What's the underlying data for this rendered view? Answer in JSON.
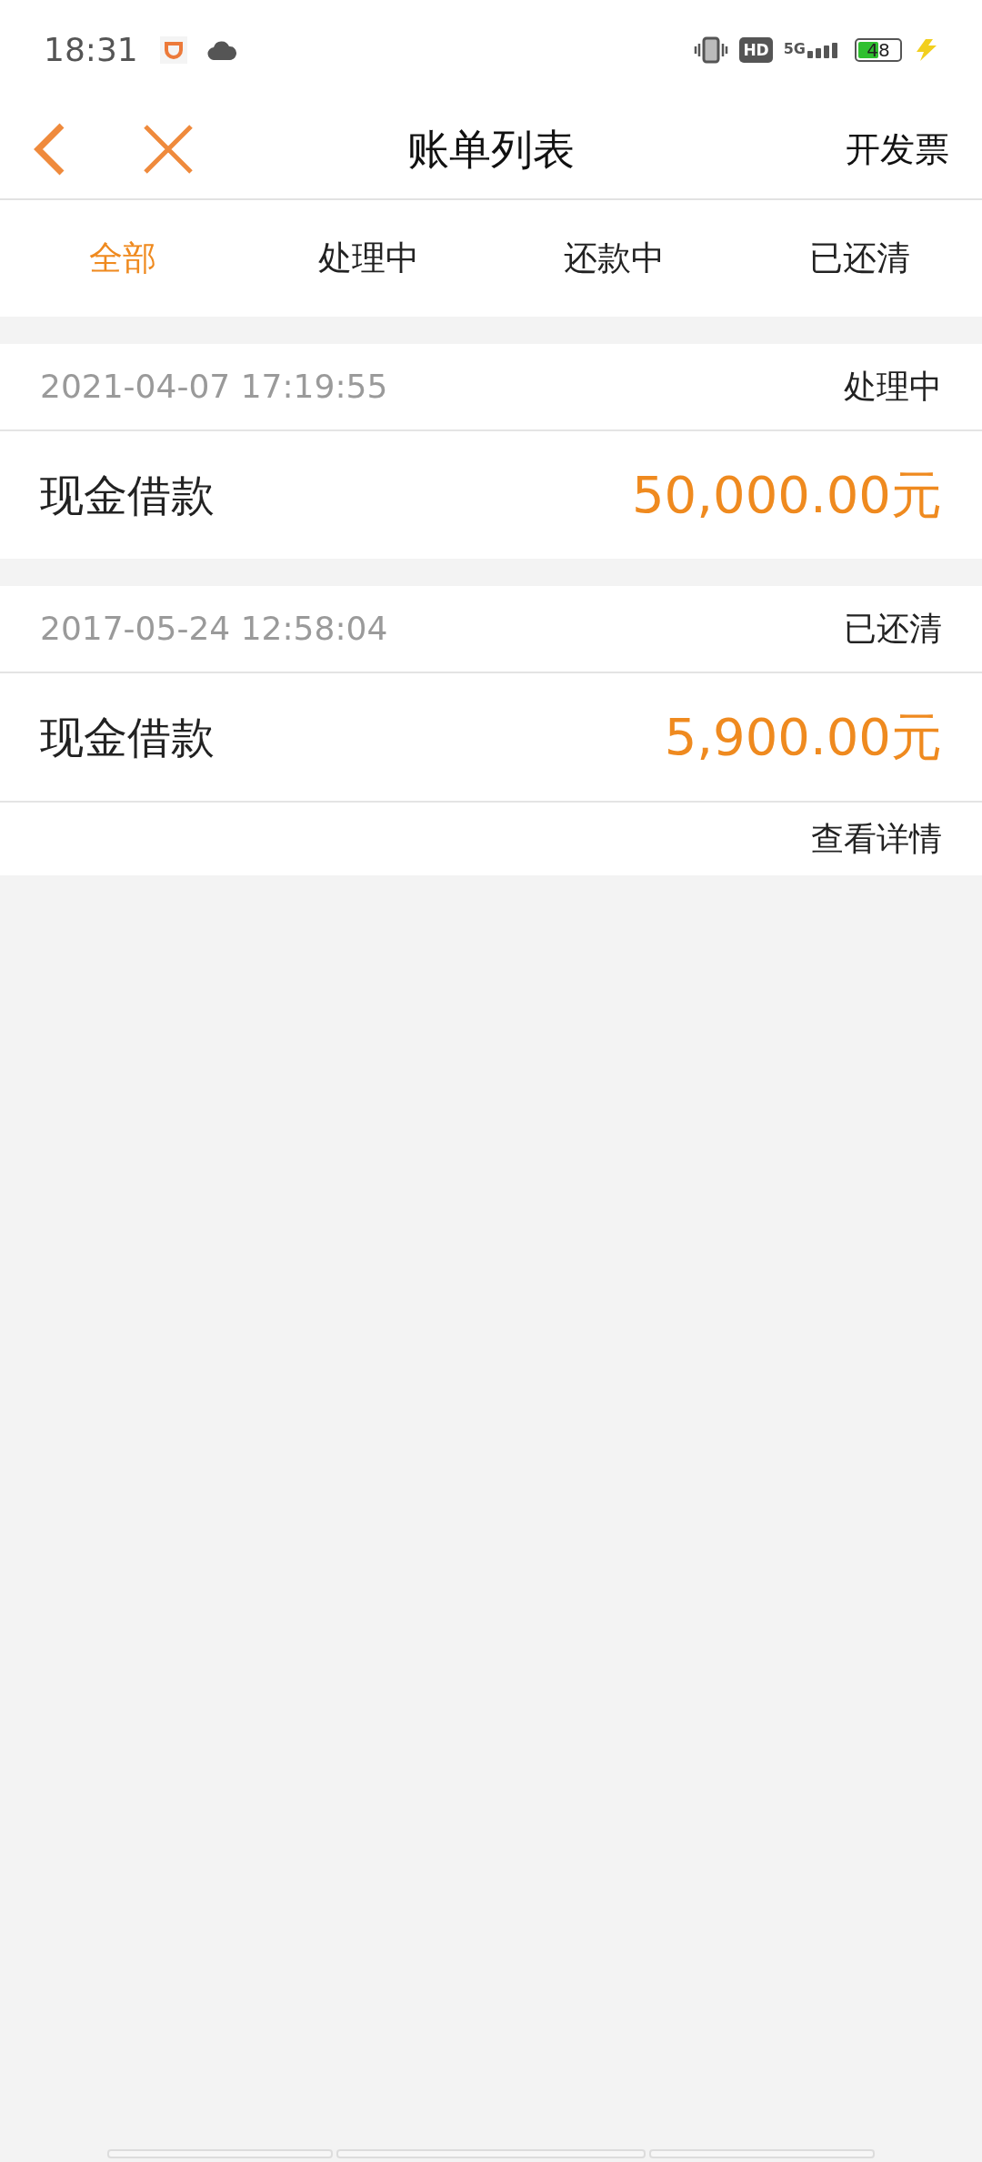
{
  "status_bar": {
    "time": "18:31",
    "network": "5G",
    "hd": "HD",
    "battery": "48"
  },
  "header": {
    "title": "账单列表",
    "action": "开发票"
  },
  "tabs": [
    {
      "label": "全部",
      "selected": true
    },
    {
      "label": "处理中",
      "selected": false
    },
    {
      "label": "还款中",
      "selected": false
    },
    {
      "label": "已还清",
      "selected": false
    }
  ],
  "bills": [
    {
      "time": "2021-04-07 17:19:55",
      "status": "处理中",
      "name": "现金借款",
      "amount": "50,000.00元"
    },
    {
      "time": "2017-05-24 12:58:04",
      "status": "已还清",
      "name": "现金借款",
      "amount": "5,900.00元",
      "link": "查看详情"
    }
  ]
}
